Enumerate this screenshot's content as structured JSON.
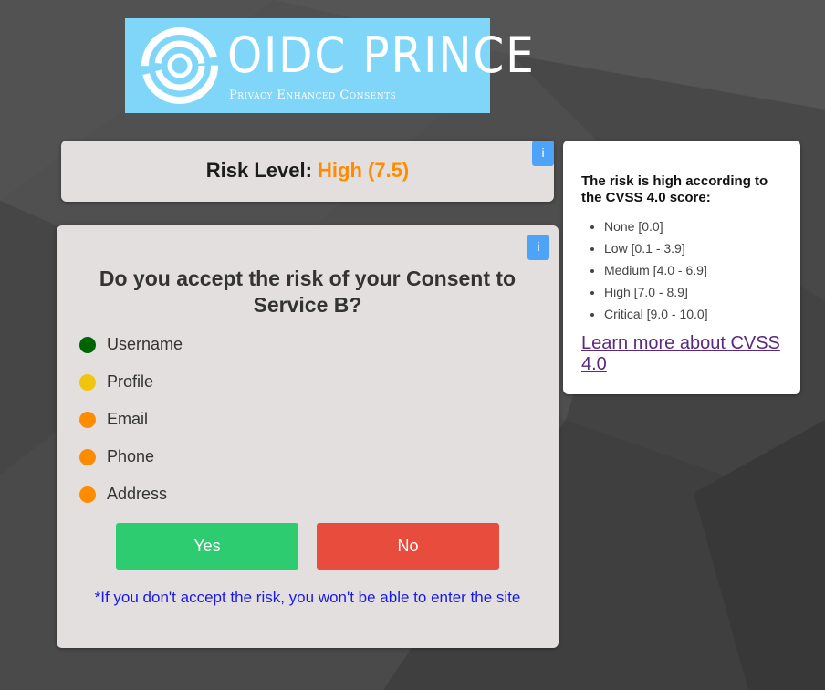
{
  "logo": {
    "title": "OIDC PRINCE",
    "subtitle": "Privacy Enhanced Consents"
  },
  "risk": {
    "label": "Risk Level:",
    "value": "High (7.5)",
    "value_color": "#ff8c00",
    "info_label": "i"
  },
  "consent": {
    "info_label": "i",
    "question": "Do you accept the risk of your Consent to Service B?",
    "attributes": [
      {
        "label": "Username",
        "color": "#006400"
      },
      {
        "label": "Profile",
        "color": "#f1c40f"
      },
      {
        "label": "Email",
        "color": "#ff8c00"
      },
      {
        "label": "Phone",
        "color": "#ff8c00"
      },
      {
        "label": "Address",
        "color": "#ff8c00"
      }
    ],
    "yes_label": "Yes",
    "no_label": "No",
    "note": "*If you don't accept the risk, you won't be able to enter the site"
  },
  "info_panel": {
    "title": "The risk is high according to the CVSS 4.0 score:",
    "levels": [
      "None [0.0]",
      "Low [0.1 - 3.9]",
      "Medium [4.0 - 6.9]",
      "High [7.0 - 8.9]",
      "Critical [9.0 - 10.0]"
    ],
    "link_text": "Learn more about CVSS 4.0"
  },
  "colors": {
    "yes": "#2ecc71",
    "no": "#e74c3c",
    "info_button": "#4da3f7",
    "logo_bg": "#7fd6f8"
  }
}
